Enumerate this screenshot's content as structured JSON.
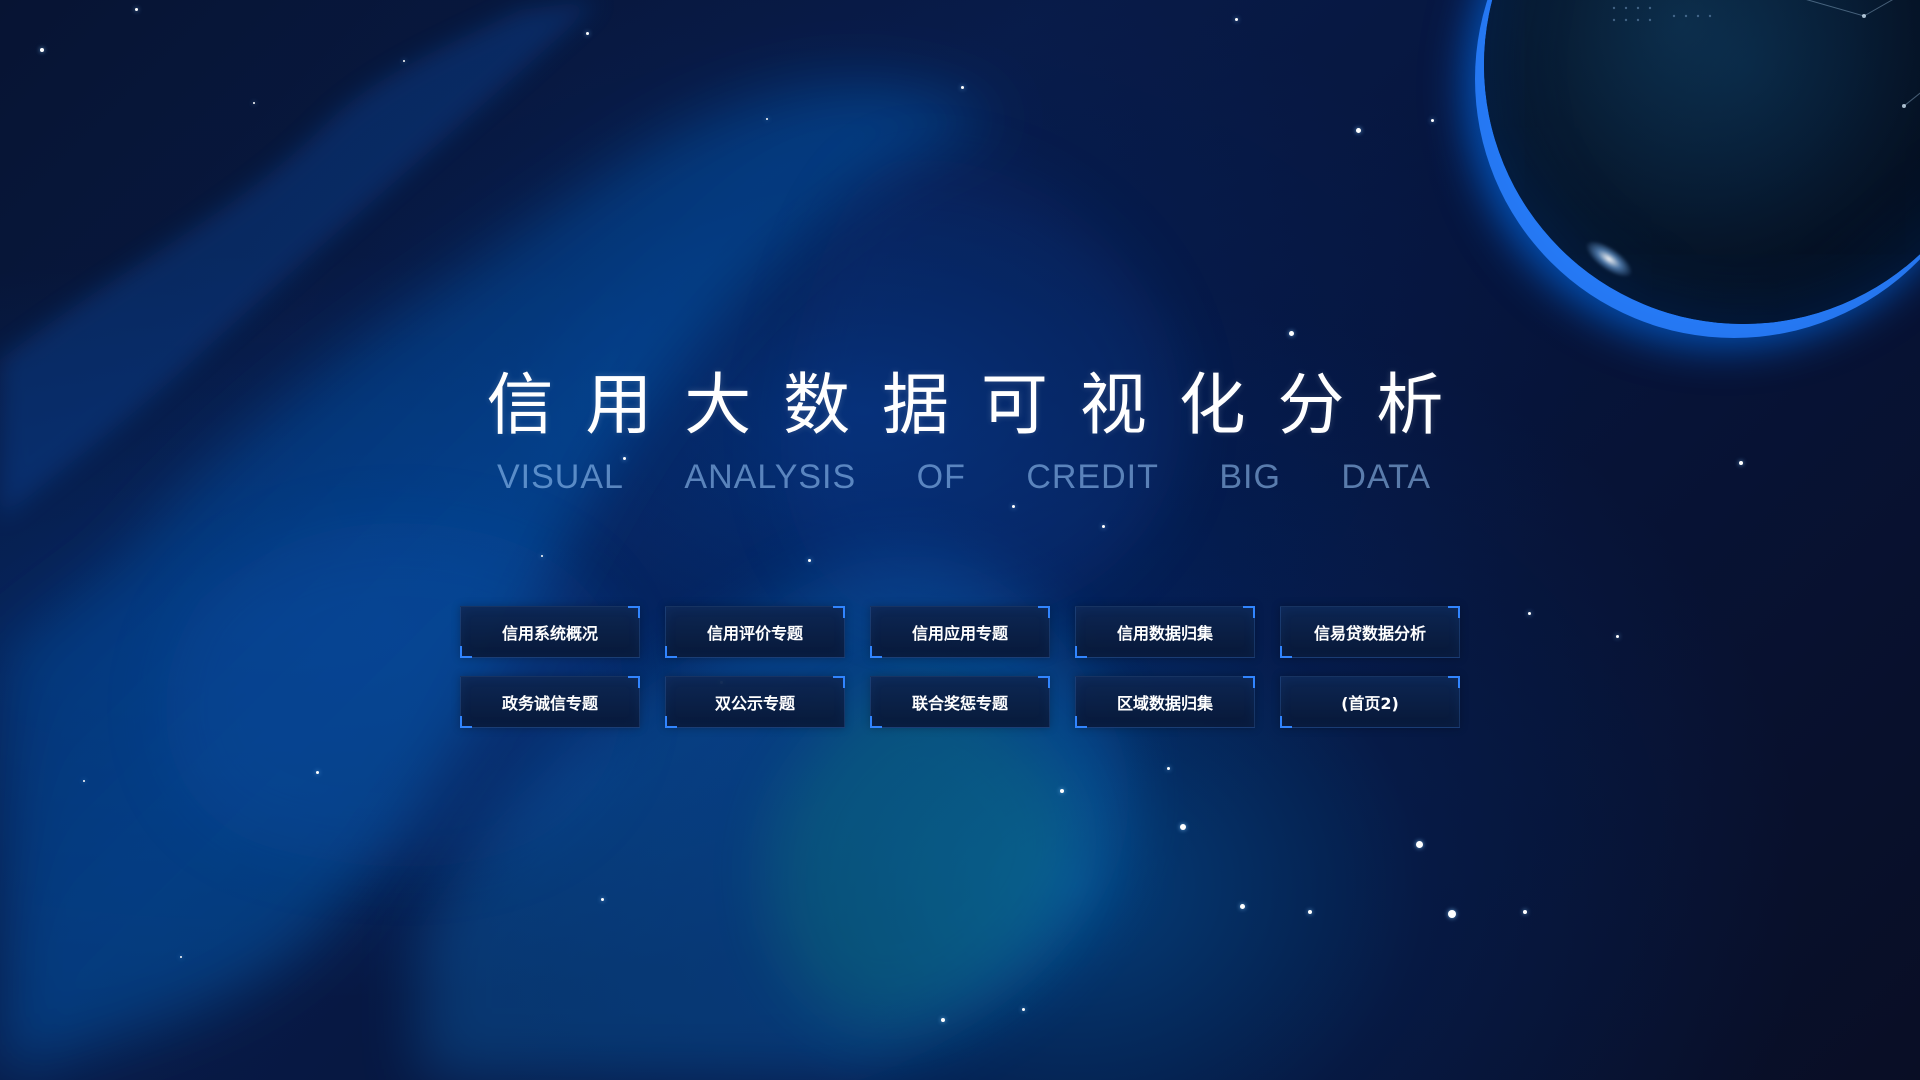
{
  "colors": {
    "background_deep": "#07112a",
    "background_blue": "#08286b",
    "nebula_blue": "#0b6fc7",
    "planet_rim": "#2a7fff",
    "button_corner": "#3185ff",
    "text_white": "#ffffff",
    "subtitle_blue": "#a0cdff"
  },
  "header": {
    "title_chars": [
      "信",
      "用",
      "大",
      "数",
      "据",
      "可",
      "视",
      "化",
      "分",
      "析"
    ],
    "subtitle_words": [
      "VISUAL",
      "ANALYSIS",
      "OF",
      "CREDIT",
      "BIG",
      "DATA"
    ]
  },
  "menu": {
    "items": [
      {
        "label": "信用系统概况"
      },
      {
        "label": "信用评价专题"
      },
      {
        "label": "信用应用专题"
      },
      {
        "label": "信用数据归集"
      },
      {
        "label": "信易贷数据分析"
      },
      {
        "label": "政务诚信专题"
      },
      {
        "label": "双公示专题"
      },
      {
        "label": "联合奖惩专题"
      },
      {
        "label": "区域数据归集"
      },
      {
        "label": "(首页2)"
      }
    ]
  },
  "background": {
    "planet_icon": "planet-icon",
    "stars_icon": "star-icon"
  }
}
